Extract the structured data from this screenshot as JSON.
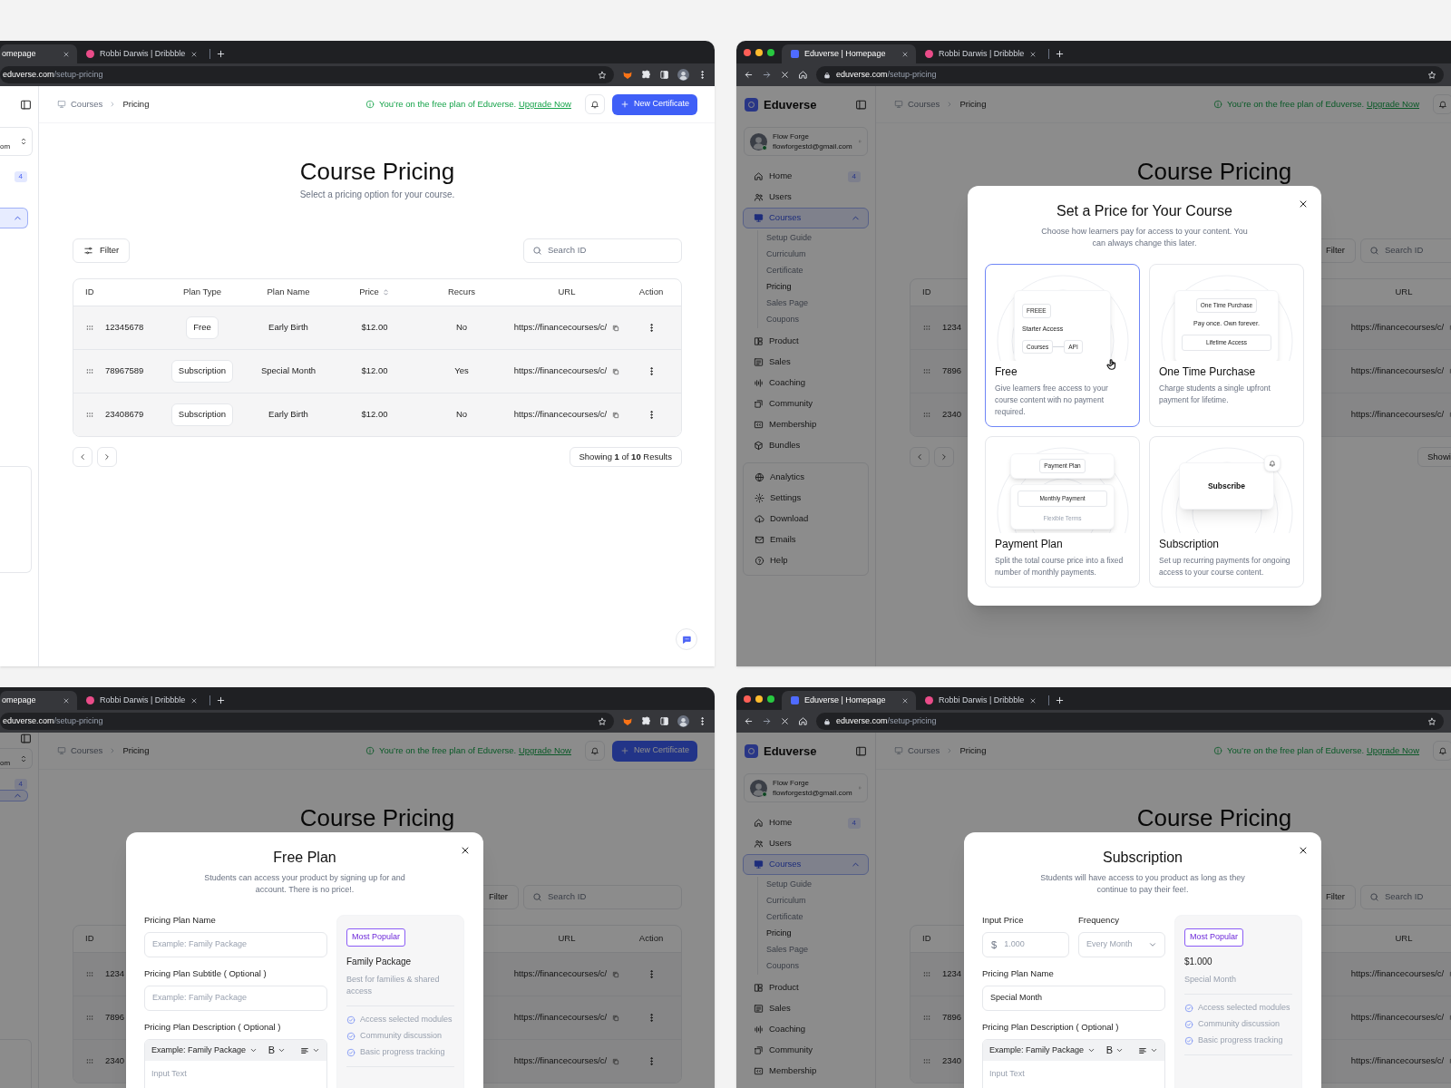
{
  "windows": [
    {
      "browser": {
        "traffic_lights": false,
        "nav_buttons": false,
        "extensions_visible": true,
        "tabs": [
          {
            "title": "omepage",
            "favicon": false,
            "selected": true
          },
          {
            "title": "Robbi Darwis | Dribbble",
            "favicon": true,
            "selected": false
          }
        ],
        "address": {
          "host": "eduverse.com",
          "path": "/setup-pricing",
          "lock": false
        }
      },
      "sidebar": {
        "kind": "cropped",
        "user": {
          "email": "om"
        },
        "items": [
          {
            "badge": "4",
            "selected": false
          },
          {
            "selected": true,
            "expanded": true
          }
        ]
      },
      "header": {
        "breadcrumb": [
          {
            "label": "Courses",
            "current": false
          },
          {
            "label": "Pricing",
            "current": true
          }
        ],
        "notice": {
          "text": "You’re on the free plan of Eduverse.",
          "link": "Upgrade Now"
        },
        "button": "New Certificate"
      },
      "page": {
        "title": "Course Pricing",
        "subtitle": "Select a pricing option for your course.",
        "filter": {
          "label": "Filter"
        },
        "search": {
          "placeholder": "Search ID"
        },
        "table": {
          "header": {
            "id": "ID",
            "plan_type": "Plan Type",
            "plan_name": "Plan Name",
            "price": "Price",
            "recurs": "Recurs",
            "url": "URL",
            "action": "Action"
          },
          "rows": [
            {
              "id": "12345678",
              "plan_type": "Free",
              "plan_name": "Early Birth",
              "price": "$12.00",
              "recurs": "No",
              "url": "https://financecourses/c/"
            },
            {
              "id": "78967589",
              "plan_type": "Subscription",
              "plan_name": "Special Month",
              "price": "$12.00",
              "recurs": "Yes",
              "url": "https://financecourses/c/"
            },
            {
              "id": "23408679",
              "plan_type": "Subscription",
              "plan_name": "Early Birth",
              "price": "$12.00",
              "recurs": "No",
              "url": "https://financecourses/c/"
            }
          ]
        },
        "pagination": {
          "summary": "Showing **1** of **10** Results"
        },
        "chat_button": true
      },
      "dimmed": false
    },
    {
      "browser": {
        "traffic_lights": true,
        "nav_buttons": true,
        "extensions_visible": false,
        "tabs": [
          {
            "title": "Eduverse | Homepage",
            "favicon": true,
            "selected": true
          },
          {
            "title": "Robbi Darwis | Dribbble",
            "favicon": true,
            "selected": false
          }
        ],
        "address": {
          "host": "eduverse.com",
          "path": "/setup-pricing",
          "lock": true
        }
      },
      "sidebar": {
        "kind": "full",
        "brand": "Eduverse",
        "user": {
          "name": "Flow Forge",
          "email": "flowforgestd@gmail.com",
          "online": true
        },
        "groups": [
          {
            "items": [
              {
                "label": "Home",
                "badge": "4",
                "selected": false
              },
              {
                "label": "Users",
                "selected": false
              },
              {
                "label": "Courses",
                "selected": true,
                "expanded": true,
                "children": [
                  {
                    "label": "Setup Guide",
                    "selected": false
                  },
                  {
                    "label": "Curriculum",
                    "selected": false
                  },
                  {
                    "label": "Certificate",
                    "selected": false
                  },
                  {
                    "label": "Pricing",
                    "selected": true
                  },
                  {
                    "label": "Sales Page",
                    "selected": false
                  },
                  {
                    "label": "Coupons",
                    "selected": false
                  }
                ]
              },
              {
                "label": "Product",
                "selected": false
              },
              {
                "label": "Sales",
                "selected": false
              },
              {
                "label": "Coaching",
                "selected": false
              },
              {
                "label": "Community",
                "selected": false
              },
              {
                "label": "Membership",
                "selected": false
              },
              {
                "label": "Bundles",
                "selected": false
              }
            ]
          },
          {
            "items": [
              {
                "label": "Analytics",
                "selected": false
              },
              {
                "label": "Settings",
                "selected": false
              },
              {
                "label": "Download",
                "selected": false
              },
              {
                "label": "Emails",
                "selected": false
              },
              {
                "label": "Help",
                "selected": false
              }
            ]
          }
        ]
      },
      "header": {
        "breadcrumb": [
          {
            "label": "Courses",
            "current": false
          },
          {
            "label": "Pricing",
            "current": true
          }
        ],
        "notice": {
          "text": "You’re on the free plan of Eduverse.",
          "link": "Upgrade Now"
        }
      },
      "page": {
        "title": "Course Pricing",
        "filter": {
          "label": "Filter"
        },
        "search": {
          "placeholder": "Search ID"
        },
        "table": {
          "header": {
            "id": "ID",
            "url": "URL"
          },
          "rows": [
            {
              "id": "1234",
              "url": "https://financecourses/c/"
            },
            {
              "id": "7896",
              "url": "https://financecourses/c/"
            },
            {
              "id": "2340",
              "url": "https://financecourses/c/"
            }
          ]
        },
        "pagination": {
          "summary": "Showi"
        }
      },
      "dimmed": true,
      "modal": {
        "kind": "picker",
        "title": "Set a Price for Your Course",
        "subtitle": "Choose how learners pay for access to your content. You can always change this later.",
        "options": [
          {
            "title": "Free",
            "description": "Give learners free access to your course content with no payment required.",
            "selected": true,
            "hovered": true,
            "preview": {
              "kind": "free",
              "chip": "FREEE",
              "heading": "Starter Access",
              "tags": [
                "Courses",
                "API"
              ]
            }
          },
          {
            "title": "One Time Purchase",
            "description": "Charge students a single upfront payment for lifetime.",
            "selected": false,
            "hovered": false,
            "preview": {
              "kind": "one_time",
              "chip": "One Time Purchase",
              "heading": "Pay once. Own forever.",
              "field": "Lifetime Access"
            }
          },
          {
            "title": "Payment Plan",
            "description": "Split the total course price into a fixed number of monthly payments.",
            "selected": false,
            "hovered": false,
            "preview": {
              "kind": "installments",
              "chip": "Payment Plan",
              "field": "Monthly Payment",
              "faded": "Flexible Terms"
            }
          },
          {
            "title": "Subscription",
            "description": "Set up recurring payments for ongoing access to your course content.",
            "selected": false,
            "hovered": false,
            "preview": {
              "kind": "subscription",
              "heading": "Subscribe"
            }
          }
        ]
      }
    },
    {
      "browser": {
        "traffic_lights": false,
        "nav_buttons": false,
        "extensions_visible": true,
        "tabs": [
          {
            "title": "omepage",
            "favicon": false,
            "selected": true
          },
          {
            "title": "Robbi Darwis | Dribbble",
            "favicon": true,
            "selected": false
          }
        ],
        "address": {
          "host": "eduverse.com",
          "path": "/setup-pricing",
          "lock": false
        }
      },
      "sidebar": {
        "kind": "cropped",
        "user": {
          "email": "om"
        },
        "items": [
          {
            "badge": "4",
            "selected": false
          },
          {
            "selected": true,
            "expanded": true
          }
        ]
      },
      "header": {
        "breadcrumb": [
          {
            "label": "Courses",
            "current": false
          },
          {
            "label": "Pricing",
            "current": true
          }
        ],
        "notice": {
          "text": "You’re on the free plan of Eduverse.",
          "link": "Upgrade Now"
        },
        "button": "New Certificate"
      },
      "page": {
        "title": "Course Pricing",
        "filter": {
          "label": "Filter"
        },
        "search": {
          "placeholder": "Search ID"
        },
        "table": {
          "header": {
            "id": "ID",
            "url": "URL",
            "action": "Action"
          },
          "rows": [
            {
              "id": "1234",
              "url": "https://financecourses/c/"
            },
            {
              "id": "7896",
              "url": "https://financecourses/c/"
            },
            {
              "id": "2340",
              "url": "https://financecourses/c/"
            }
          ]
        }
      },
      "dimmed": true,
      "modal": {
        "kind": "form",
        "title": "Free Plan",
        "subtitle": "Students can access your product by signing up for and account. There is no price!.",
        "fields": [
          {
            "kind": "text",
            "label": "Pricing Plan Name",
            "placeholder": "Example: Family Package"
          },
          {
            "kind": "text",
            "label": "Pricing Plan Subtitle ( Optional )",
            "placeholder": "Example: Family Package"
          },
          {
            "kind": "editor",
            "label": "Pricing Plan Description ( Optional )",
            "format": "Example: Family Package",
            "bold": "B",
            "placeholder": "Input Text"
          }
        ],
        "preview": {
          "badge": "Most Popular",
          "title": "Family Package",
          "description": "Best for families & shared access",
          "features": [
            "Access selected modules",
            "Community discussion",
            "Basic progress tracking"
          ]
        }
      }
    },
    {
      "browser": {
        "traffic_lights": true,
        "nav_buttons": true,
        "extensions_visible": false,
        "tabs": [
          {
            "title": "Eduverse | Homepage",
            "favicon": true,
            "selected": true
          },
          {
            "title": "Robbi Darwis | Dribbble",
            "favicon": true,
            "selected": false
          }
        ],
        "address": {
          "host": "eduverse.com",
          "path": "/setup-pricing",
          "lock": true
        }
      },
      "sidebar": {
        "kind": "full",
        "brand": "Eduverse",
        "user": {
          "name": "Flow Forge",
          "email": "flowforgestd@gmail.com",
          "online": true
        },
        "groups": [
          {
            "items": [
              {
                "label": "Home",
                "badge": "4",
                "selected": false
              },
              {
                "label": "Users",
                "selected": false
              },
              {
                "label": "Courses",
                "selected": true,
                "expanded": true,
                "children": [
                  {
                    "label": "Setup Guide",
                    "selected": false
                  },
                  {
                    "label": "Curriculum",
                    "selected": false
                  },
                  {
                    "label": "Certificate",
                    "selected": false
                  },
                  {
                    "label": "Pricing",
                    "selected": true
                  },
                  {
                    "label": "Sales Page",
                    "selected": false
                  },
                  {
                    "label": "Coupons",
                    "selected": false
                  }
                ]
              },
              {
                "label": "Product",
                "selected": false
              },
              {
                "label": "Sales",
                "selected": false
              },
              {
                "label": "Coaching",
                "selected": false
              },
              {
                "label": "Community",
                "selected": false
              },
              {
                "label": "Membership",
                "selected": false
              }
            ]
          }
        ]
      },
      "header": {
        "breadcrumb": [
          {
            "label": "Courses",
            "current": false
          },
          {
            "label": "Pricing",
            "current": true
          }
        ],
        "notice": {
          "text": "You’re on the free plan of Eduverse.",
          "link": "Upgrade Now"
        }
      },
      "page": {
        "title": "Course Pricing",
        "filter": {
          "label": "Filter"
        },
        "search": {
          "placeholder": "Search ID"
        },
        "table": {
          "header": {
            "id": "ID",
            "url": "URL"
          },
          "rows": [
            {
              "id": "1234",
              "url": "https://financecourses/c/"
            },
            {
              "id": "7896",
              "url": "https://financecourses/c/"
            },
            {
              "id": "2340",
              "url": "https://financecourses/c/"
            }
          ]
        }
      },
      "dimmed": true,
      "modal": {
        "kind": "form",
        "title": "Subscription",
        "subtitle": "Students will have access to you product as long as they continue to pay their fee!.",
        "fields": [
          {
            "kind": "row",
            "fields": [
              {
                "kind": "price",
                "label": "Input Price",
                "prefix": "$",
                "placeholder": "1.000"
              },
              {
                "kind": "select",
                "label": "Frequency",
                "value": "Every Month"
              }
            ]
          },
          {
            "kind": "text",
            "label": "Pricing Plan Name",
            "value": "Special Month"
          },
          {
            "kind": "editor",
            "label": "Pricing Plan Description ( Optional )",
            "format": "Example: Family Package",
            "bold": "B",
            "placeholder": "Input Text"
          }
        ],
        "preview": {
          "badge": "Most Popular",
          "title": "$1.000",
          "description": "Special Month",
          "features": [
            "Access selected modules",
            "Community discussion",
            "Basic progress tracking"
          ]
        }
      }
    }
  ]
}
